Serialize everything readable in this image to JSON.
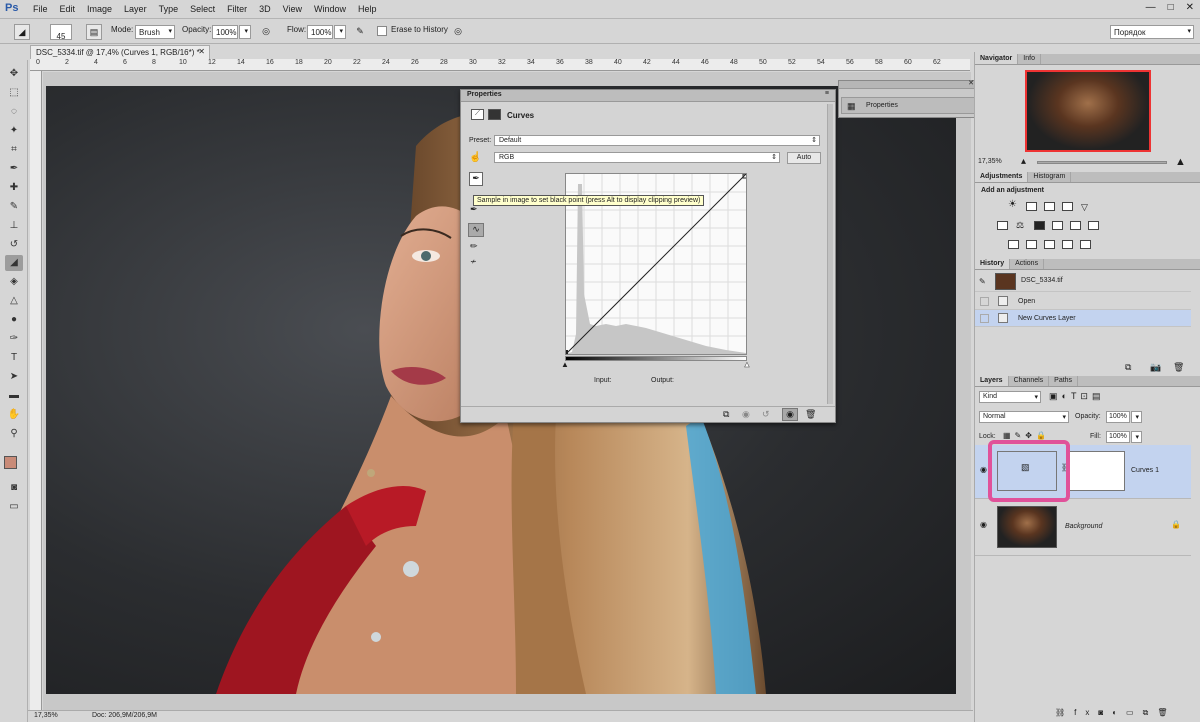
{
  "menubar": {
    "logo": "Ps",
    "items": [
      "File",
      "Edit",
      "Image",
      "Layer",
      "Type",
      "Select",
      "Filter",
      "3D",
      "View",
      "Window",
      "Help"
    ],
    "window_controls": [
      "—",
      "□",
      "✕"
    ]
  },
  "options": {
    "brush_size": "45",
    "mode_label": "Mode:",
    "mode_value": "Brush",
    "opacity_label": "Opacity:",
    "opacity_value": "100%",
    "flow_label": "Flow:",
    "flow_value": "100%",
    "erase_history_label": "Erase to History",
    "workspace_value": "Порядок"
  },
  "document": {
    "tab_title": "DSC_5334.tif @ 17,4% (Curves 1, RGB/16*) *",
    "ruler_ticks": [
      "0",
      "2",
      "4",
      "6",
      "8",
      "10",
      "12",
      "14",
      "16",
      "18",
      "20",
      "22",
      "24",
      "26",
      "28",
      "30",
      "32",
      "34",
      "36",
      "38",
      "40",
      "42",
      "44",
      "46",
      "48",
      "50",
      "52",
      "54",
      "56",
      "58",
      "60",
      "62"
    ],
    "status_zoom": "17,35%",
    "status_doc": "Doc: 206,9M/206,9M"
  },
  "properties": {
    "panel_title": "Properties",
    "layer_type": "Curves",
    "preset_label": "Preset:",
    "preset_value": "Default",
    "channel_value": "RGB",
    "auto_button": "Auto",
    "tooltip": "Sample in image to set black point (press Alt to display clipping preview)",
    "input_label": "Input:",
    "output_label": "Output:"
  },
  "float_panel": {
    "label": "Properties"
  },
  "navigator": {
    "tabs": [
      "Navigator",
      "Info"
    ],
    "zoom": "17,35%"
  },
  "adjustments": {
    "tabs": [
      "Adjustments",
      "Histogram"
    ],
    "heading": "Add an adjustment"
  },
  "history": {
    "tabs": [
      "History",
      "Actions"
    ],
    "items": [
      "DSC_5334.tif",
      "Open",
      "New Curves Layer"
    ]
  },
  "layers": {
    "tabs": [
      "Layers",
      "Channels",
      "Paths"
    ],
    "kind_value": "Kind",
    "blend_value": "Normal",
    "opacity_label": "Opacity:",
    "opacity_value": "100%",
    "lock_label": "Lock:",
    "fill_label": "Fill:",
    "fill_value": "100%",
    "items": [
      "Curves 1",
      "Background"
    ]
  },
  "colors": {
    "highlight": "#e0529a",
    "selected_row": "#c3d3ef",
    "ps_blue": "#2a5aa8"
  }
}
